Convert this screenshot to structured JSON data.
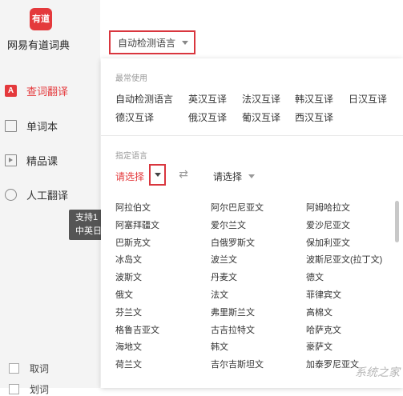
{
  "sidebar": {
    "logo_text": "有道",
    "app_title": "网易有道词典",
    "items": [
      {
        "label": "查词翻译",
        "icon": "translate-icon",
        "active": true
      },
      {
        "label": "单词本",
        "icon": "wordbook-icon"
      },
      {
        "label": "精品课",
        "icon": "course-icon"
      },
      {
        "label": "人工翻译",
        "icon": "human-translate-icon"
      }
    ],
    "tooltip": "支持1\n中英日",
    "bottom": [
      {
        "label": "取词"
      },
      {
        "label": "划词"
      }
    ]
  },
  "lang_button": {
    "label": "自动检测语言"
  },
  "dropdown": {
    "frequent_label": "最常使用",
    "frequent": [
      "自动检测语言",
      "英汉互译",
      "法汉互译",
      "韩汉互译",
      "日汉互译",
      "德汉互译",
      "俄汉互译",
      "葡汉互译",
      "西汉互译"
    ],
    "specify_label": "指定语言",
    "source_select": "请选择",
    "target_select": "请选择",
    "languages": [
      [
        "阿拉伯文",
        "阿尔巴尼亚文",
        "阿姆哈拉文"
      ],
      [
        "阿塞拜疆文",
        "爱尔兰文",
        "爱沙尼亚文"
      ],
      [
        "巴斯克文",
        "白俄罗斯文",
        "保加利亚文"
      ],
      [
        "冰岛文",
        "波兰文",
        "波斯尼亚文(拉丁文)"
      ],
      [
        "波斯文",
        "丹麦文",
        "德文"
      ],
      [
        "俄文",
        "法文",
        "菲律宾文"
      ],
      [
        "芬兰文",
        "弗里斯兰文",
        "高棉文"
      ],
      [
        "格鲁吉亚文",
        "古吉拉特文",
        "哈萨克文"
      ],
      [
        "海地文",
        "韩文",
        "豪萨文"
      ],
      [
        "荷兰文",
        "吉尔吉斯坦文",
        "加泰罗尼亚文"
      ]
    ]
  },
  "watermark": "系统之家"
}
